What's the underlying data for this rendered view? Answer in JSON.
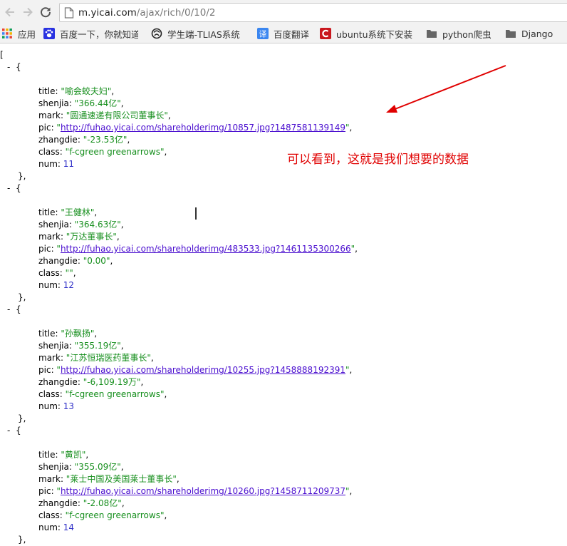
{
  "browser": {
    "url_host": "m.yicai.com",
    "url_path": "/ajax/rich/0/10/2"
  },
  "bookmarks": [
    {
      "label": "应用",
      "icon": "apps-grid-icon"
    },
    {
      "label": "百度一下，你就知道",
      "icon": "baidu-paw-icon"
    },
    {
      "label": "学生端-TLIAS系统",
      "icon": "tlias-logo-icon"
    },
    {
      "label": "百度翻译",
      "icon": "baidu-translate-icon"
    },
    {
      "label": "ubuntu系统下安装",
      "icon": "csdn-c-icon"
    },
    {
      "label": "python爬虫",
      "icon": "folder-icon"
    },
    {
      "label": "Django",
      "icon": "folder-icon"
    }
  ],
  "json_view": {
    "open_bracket": "[",
    "collapse_marker": "-",
    "open_brace": "{",
    "close_brace": "},",
    "records": [
      {
        "title": "喻会蛟夫妇",
        "shenjia": "366.44亿",
        "mark": "圆通速递有限公司董事长",
        "pic": "http://fuhao.yicai.com/shareholderimg/10857.jpg?1487581139149",
        "zhangdie": "-23.53亿",
        "class": "f-cgreen greenarrows",
        "num": "11"
      },
      {
        "title": "王健林",
        "shenjia": "364.63亿",
        "mark": "万达董事长",
        "pic": "http://fuhao.yicai.com/shareholderimg/483533.jpg?1461135300266",
        "zhangdie": "0.00",
        "class": "",
        "num": "12"
      },
      {
        "title": "孙飘扬",
        "shenjia": "355.19亿",
        "mark": "江苏恒瑞医药董事长",
        "pic": "http://fuhao.yicai.com/shareholderimg/10255.jpg?1458888192391",
        "zhangdie": "-6,109.19万",
        "class": "f-cgreen greenarrows",
        "num": "13"
      },
      {
        "title": "黄凯",
        "shenjia": "355.09亿",
        "mark": "莱士中国及美国莱士董事长",
        "pic": "http://fuhao.yicai.com/shareholderimg/10260.jpg?1458711209737",
        "zhangdie": "-2.08亿",
        "class": "f-cgreen greenarrows",
        "num": "14"
      }
    ]
  },
  "annotation": {
    "text": "可以看到，这就是我们想要的数据",
    "color": "#e00000"
  }
}
